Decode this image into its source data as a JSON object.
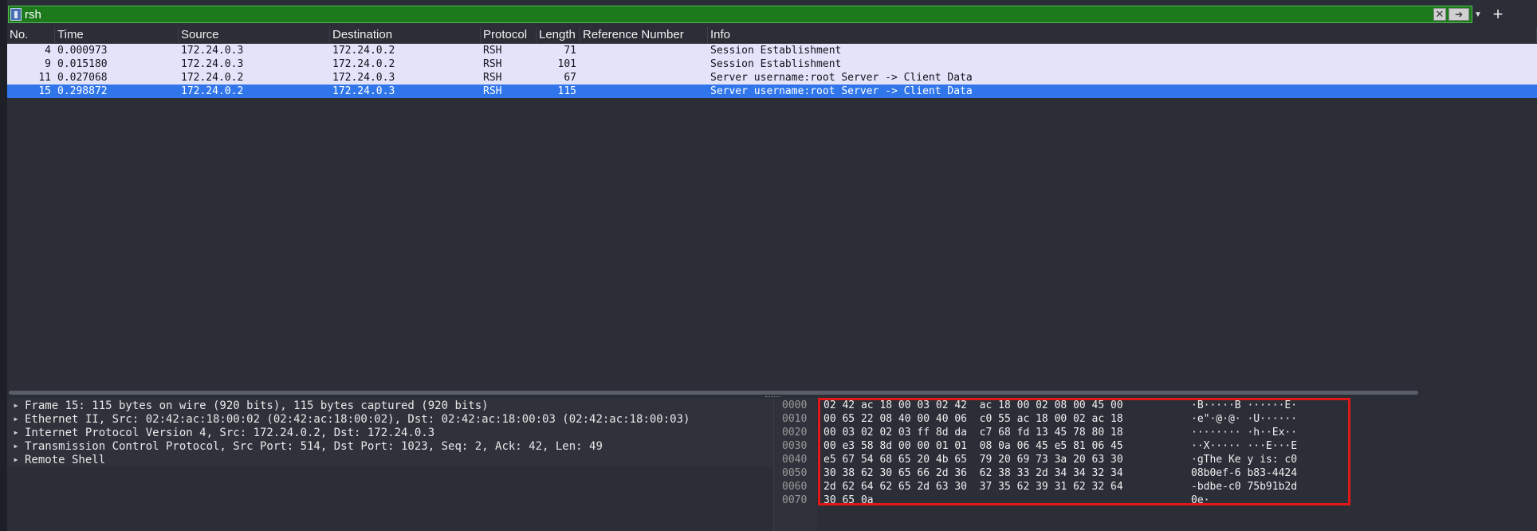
{
  "filter": {
    "value": "rsh"
  },
  "columns": [
    "No.",
    "Time",
    "Source",
    "Destination",
    "Protocol",
    "Length",
    "Reference Number",
    "Info"
  ],
  "packets": [
    {
      "no": "4",
      "time": "0.000973",
      "src": "172.24.0.3",
      "dst": "172.24.0.2",
      "proto": "RSH",
      "len": "71",
      "ref": "",
      "info": "Session Establishment"
    },
    {
      "no": "9",
      "time": "0.015180",
      "src": "172.24.0.3",
      "dst": "172.24.0.2",
      "proto": "RSH",
      "len": "101",
      "ref": "",
      "info": "Session Establishment"
    },
    {
      "no": "11",
      "time": "0.027068",
      "src": "172.24.0.2",
      "dst": "172.24.0.3",
      "proto": "RSH",
      "len": "67",
      "ref": "",
      "info": "Server username:root Server -> Client Data"
    },
    {
      "no": "15",
      "time": "0.298872",
      "src": "172.24.0.2",
      "dst": "172.24.0.3",
      "proto": "RSH",
      "len": "115",
      "ref": "",
      "info": "Server username:root Server -> Client Data"
    }
  ],
  "details": [
    "Frame 15: 115 bytes on wire (920 bits), 115 bytes captured (920 bits)",
    "Ethernet II, Src: 02:42:ac:18:00:02 (02:42:ac:18:00:02), Dst: 02:42:ac:18:00:03 (02:42:ac:18:00:03)",
    "Internet Protocol Version 4, Src: 172.24.0.2, Dst: 172.24.0.3",
    "Transmission Control Protocol, Src Port: 514, Dst Port: 1023, Seq: 2, Ack: 42, Len: 49",
    "Remote Shell"
  ],
  "bytes": [
    {
      "offset": "0000",
      "hex": "02 42 ac 18 00 03 02 42  ac 18 00 02 08 00 45 00",
      "ascii": "·B·····B ······E·"
    },
    {
      "offset": "0010",
      "hex": "00 65 22 08 40 00 40 06  c0 55 ac 18 00 02 ac 18",
      "ascii": "·e\"·@·@· ·U······"
    },
    {
      "offset": "0020",
      "hex": "00 03 02 02 03 ff 8d da  c7 68 fd 13 45 78 80 18",
      "ascii": "········ ·h··Ex··"
    },
    {
      "offset": "0030",
      "hex": "00 e3 58 8d 00 00 01 01  08 0a 06 45 e5 81 06 45",
      "ascii": "··X····· ···E···E"
    },
    {
      "offset": "0040",
      "hex": "e5 67 54 68 65 20 4b 65  79 20 69 73 3a 20 63 30",
      "ascii": "·gThe Ke y is: c0"
    },
    {
      "offset": "0050",
      "hex": "30 38 62 30 65 66 2d 36  62 38 33 2d 34 34 32 34",
      "ascii": "08b0ef-6 b83-4424"
    },
    {
      "offset": "0060",
      "hex": "2d 62 64 62 65 2d 63 30  37 35 62 39 31 62 32 64",
      "ascii": "-bdbe-c0 75b91b2d"
    },
    {
      "offset": "0070",
      "hex": "30 65 0a",
      "ascii": "0e·"
    }
  ]
}
